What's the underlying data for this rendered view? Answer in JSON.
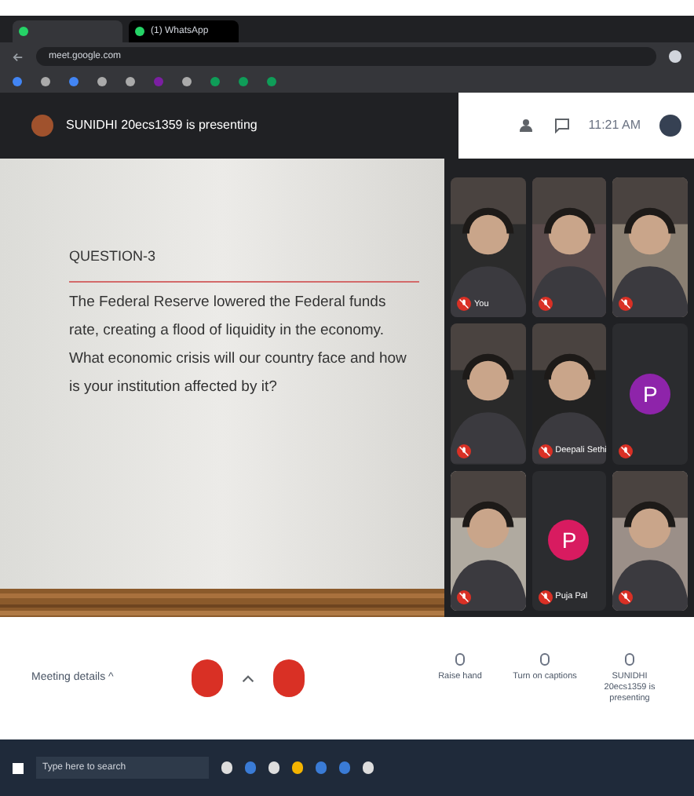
{
  "browser": {
    "tabs": [
      {
        "selected": false
      },
      {
        "label": "(1) WhatsApp",
        "selected": true
      }
    ],
    "address": "meet.google.com"
  },
  "meeting": {
    "presenter": "SUNIDHI 20ecs1359 is presenting",
    "time": "11:21 AM"
  },
  "slide": {
    "title": "QUESTION-3",
    "body": "The Federal Reserve lowered the Federal funds rate, creating a flood of liquidity in the economy. What economic crisis will our country face and how is your institution affected by it?"
  },
  "tiles": [
    {
      "kind": "picture",
      "name": "You"
    },
    {
      "kind": "picture"
    },
    {
      "kind": "picture"
    },
    {
      "kind": "picture"
    },
    {
      "kind": "picture",
      "name": "Deepali Sethi"
    },
    {
      "kind": "avatar",
      "initial": "P",
      "color": "#8e24aa"
    },
    {
      "kind": "picture"
    },
    {
      "kind": "avatar",
      "initial": "P",
      "name": "Puja Pal",
      "color": "#d81b60"
    },
    {
      "kind": "picture"
    }
  ],
  "toolbar": {
    "details": "Meeting details ^",
    "actions": [
      "Raise hand",
      "Turn on captions",
      "SUNIDHI 20ecs1359 is presenting"
    ]
  },
  "taskbar": {
    "search_placeholder": "Type here to search"
  }
}
